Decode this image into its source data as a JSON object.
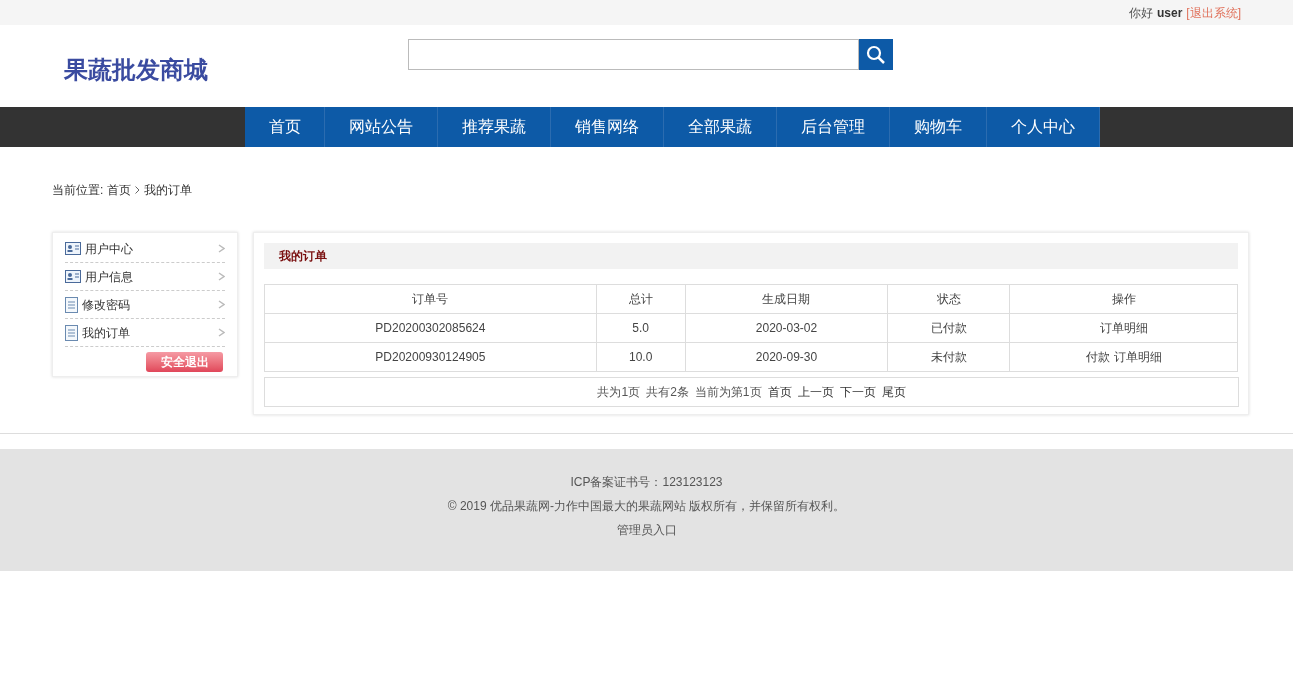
{
  "top_bar": {
    "greeting": "你好",
    "username": "user",
    "logout": "[退出系统]"
  },
  "header": {
    "logo": "果蔬批发商城"
  },
  "nav": [
    {
      "label": "首页"
    },
    {
      "label": "网站公告"
    },
    {
      "label": "推荐果蔬"
    },
    {
      "label": "销售网络"
    },
    {
      "label": "全部果蔬"
    },
    {
      "label": "后台管理"
    },
    {
      "label": "购物车"
    },
    {
      "label": "个人中心"
    }
  ],
  "breadcrumb": {
    "prefix": "当前位置:",
    "items": [
      "首页",
      "我的订单"
    ]
  },
  "sidebar": {
    "items": [
      {
        "label": "用户中心",
        "kind": "card"
      },
      {
        "label": "用户信息",
        "kind": "card"
      },
      {
        "label": "修改密码",
        "kind": "doc"
      },
      {
        "label": "我的订单",
        "kind": "doc"
      }
    ],
    "logout_button": "安全退出"
  },
  "orders": {
    "title": "我的订单",
    "columns": [
      "订单号",
      "总计",
      "生成日期",
      "状态",
      "操作"
    ],
    "rows": [
      {
        "order_no": "PD20200302085624",
        "total": "5.0",
        "date": "2020-03-02",
        "status": "已付款",
        "actions": [
          "订单明细"
        ]
      },
      {
        "order_no": "PD20200930124905",
        "total": "10.0",
        "date": "2020-09-30",
        "status": "未付款",
        "actions": [
          "付款",
          "订单明细"
        ]
      }
    ],
    "pagination": [
      {
        "kind": "text",
        "label": "共为1页"
      },
      {
        "kind": "text",
        "label": "共有2条"
      },
      {
        "kind": "text",
        "label": "当前为第1页"
      },
      {
        "kind": "link",
        "label": "首页"
      },
      {
        "kind": "link",
        "label": "上一页"
      },
      {
        "kind": "link",
        "label": "下一页"
      },
      {
        "kind": "link",
        "label": "尾页"
      }
    ]
  },
  "footer": {
    "icp": "ICP备案证书号：123123123",
    "copyright": "© 2019 优品果蔬网-力作中国最大的果蔬网站 版权所有，并保留所有权利。",
    "admin_link": "管理员入口"
  }
}
